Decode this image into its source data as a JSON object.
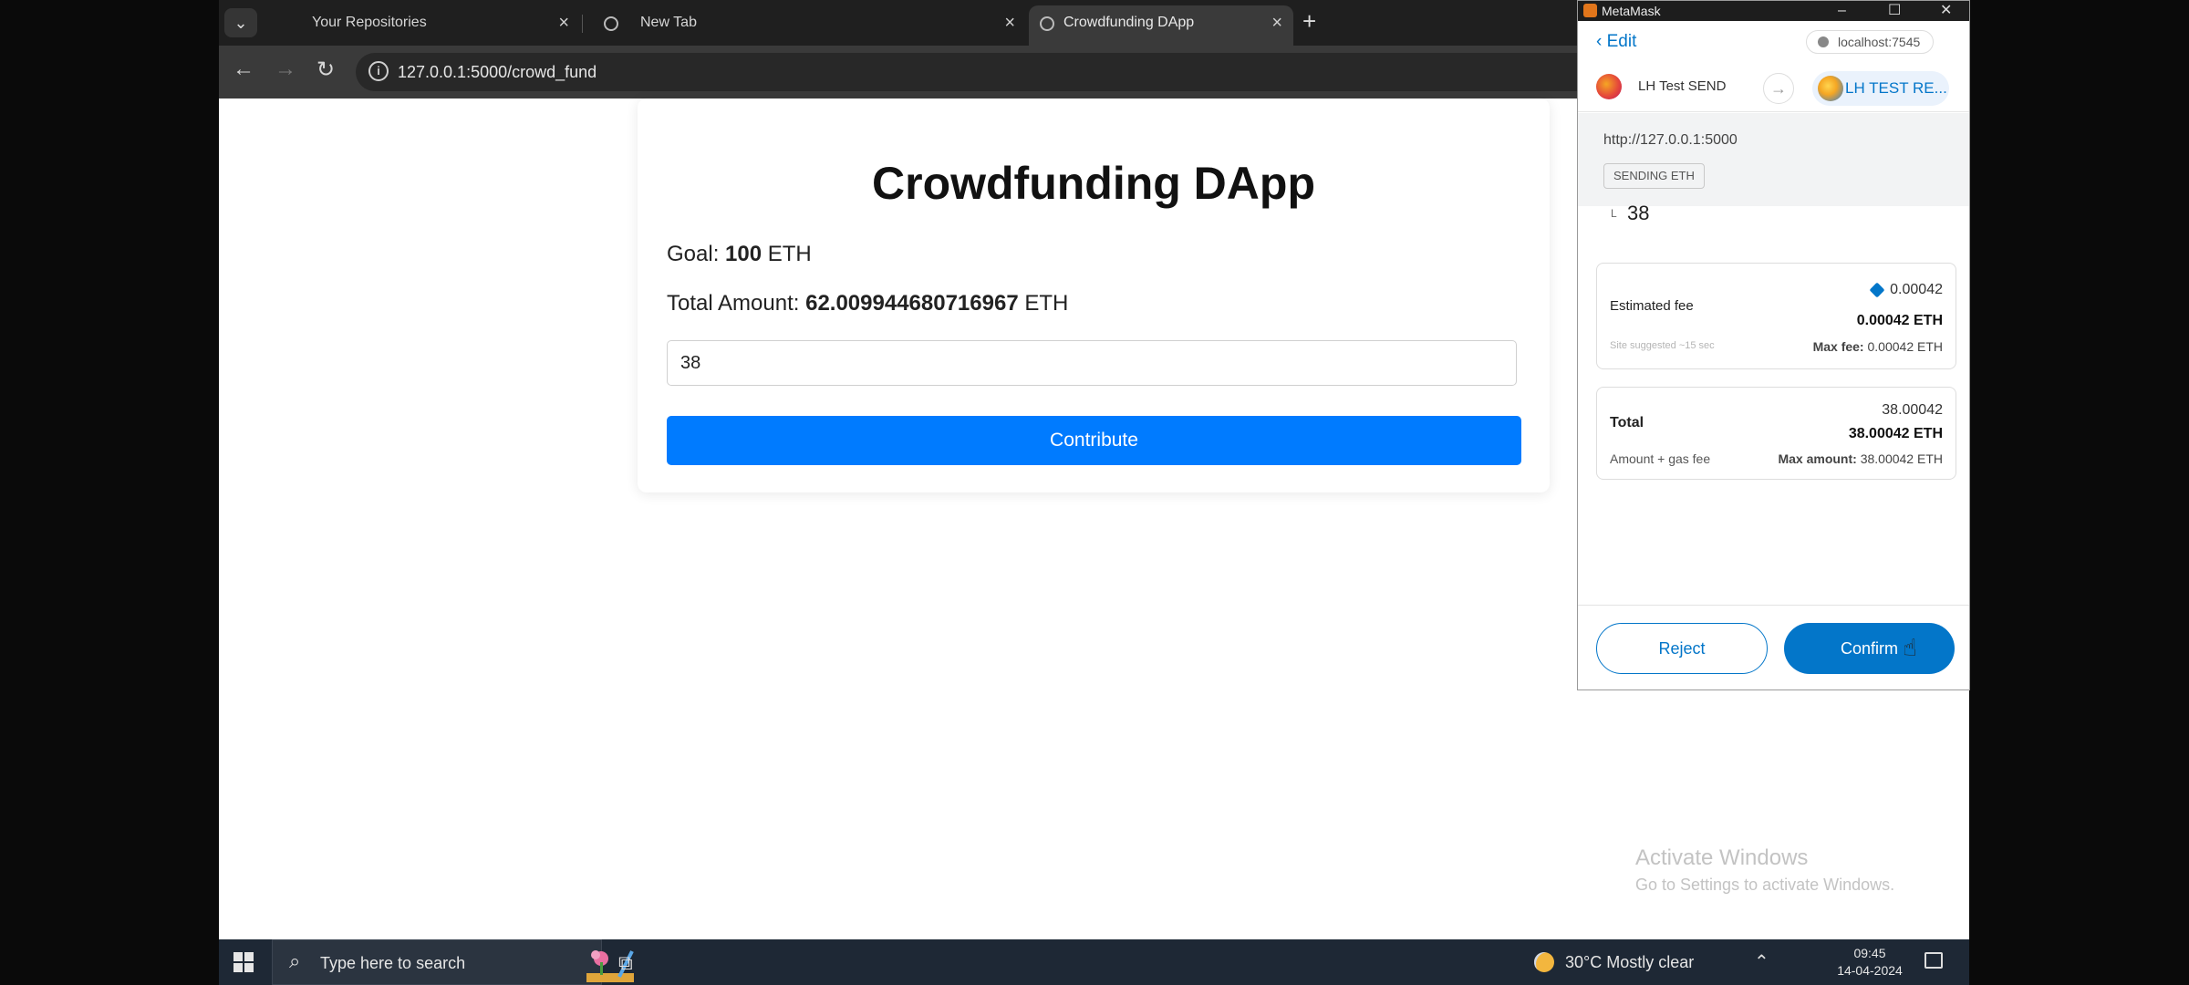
{
  "browser": {
    "tabs": [
      {
        "title": "Your Repositories",
        "active": false
      },
      {
        "title": "New Tab",
        "active": false
      },
      {
        "title": "Crowdfunding DApp",
        "active": true
      }
    ],
    "url": "127.0.0.1:5000/crowd_fund"
  },
  "page": {
    "title": "Crowdfunding DApp",
    "goal_label": "Goal:",
    "goal_value": "100",
    "goal_unit": "ETH",
    "total_label": "Total Amount:",
    "total_value": "62.009944680716967",
    "total_unit": "ETH",
    "amount_input_value": "38",
    "contribute_label": "Contribute"
  },
  "metamask": {
    "window_title": "MetaMask",
    "edit_label": "Edit",
    "origin_host": "localhost:7545",
    "from_account": "LH Test SEND",
    "to_account": "LH TEST RE...",
    "site_url": "http://127.0.0.1:5000",
    "action_badge": "SENDING ETH",
    "amount_prefix": "L",
    "amount": "38",
    "fee": {
      "label": "Estimated fee",
      "value_top": "0.00042",
      "value_main": "0.00042 ETH",
      "suggested": "Site suggested ~15 sec",
      "max_label": "Max fee:",
      "max_value": "0.00042 ETH"
    },
    "total": {
      "label": "Total",
      "value_top": "38.00042",
      "value_main": "38.00042 ETH",
      "sub_label": "Amount + gas fee",
      "max_label": "Max amount:",
      "max_value": "38.00042 ETH"
    },
    "reject_label": "Reject",
    "confirm_label": "Confirm",
    "colors": {
      "accent": "#0376c9"
    }
  },
  "watermark": {
    "line1": "Activate Windows",
    "line2": "Go to Settings to activate Windows."
  },
  "taskbar": {
    "search_placeholder": "Type here to search",
    "weather": "30°C  Mostly clear",
    "time": "09:45",
    "date": "14-04-2024"
  },
  "colors": {
    "contribute_button": "#007bff"
  }
}
